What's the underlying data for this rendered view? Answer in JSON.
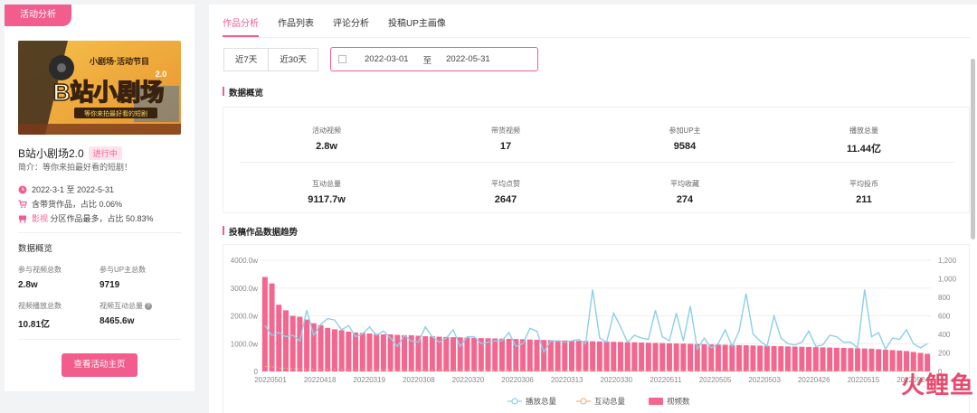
{
  "left": {
    "tag": "活动分析",
    "banner": {
      "text_top": "小剧场·活动节目",
      "text_main": "B站小剧场",
      "text_version": "2.0",
      "text_sub": "等你来拍最好看的短剧"
    },
    "title": "B站小剧场2.0",
    "status": "进行中",
    "intro": "简介：等你来拍最好看的短剧！",
    "date_range": "2022-3-1 至 2022-5-31",
    "goods_text": "含带货作品，占比 0.06%",
    "category_prefix": "影视",
    "category_text": "分区作品最多，占比 50.83%",
    "overview_title": "数据概览",
    "stats": [
      {
        "label": "参与视频总数",
        "value": "2.8w"
      },
      {
        "label": "参与UP主总数",
        "value": "9719"
      },
      {
        "label": "视频播放总数",
        "value": "10.81亿"
      },
      {
        "label": "视频互动总量",
        "value": "8465.6w"
      }
    ],
    "button": "查看活动主页"
  },
  "tabs": [
    "作品分析",
    "作品列表",
    "评论分析",
    "投稿UP主画像"
  ],
  "range_buttons": [
    "近7天",
    "近30天"
  ],
  "date_picker": {
    "start": "2022-03-01",
    "sep": "至",
    "end": "2022-05-31"
  },
  "section_overview": "数据概览",
  "overview": [
    {
      "label": "活动视频",
      "value": "2.8w"
    },
    {
      "label": "带货视频",
      "value": "17"
    },
    {
      "label": "参加UP主",
      "value": "9584"
    },
    {
      "label": "播放总量",
      "value": "11.44亿"
    },
    {
      "label": "互动总量",
      "value": "9117.7w"
    },
    {
      "label": "平均点赞",
      "value": "2647"
    },
    {
      "label": "平均收藏",
      "value": "274"
    },
    {
      "label": "平均投币",
      "value": "211"
    }
  ],
  "section_trend": "投稿作品数据趋势",
  "watermark": {
    "c1": "火",
    "c2": "鲤",
    "c3": "鱼"
  },
  "colors": {
    "accent": "#f25d8e",
    "bar": "#f2668f",
    "line_play": "#8ecfe6",
    "line_interact": "#f5b27a"
  },
  "chart_data": {
    "type": "bar",
    "left_axis_ticks": [
      "4000.0w",
      "3000.0w",
      "2000.0w",
      "1000.0w",
      "0"
    ],
    "right_axis_ticks": [
      "1,200",
      "1,000",
      "800",
      "600",
      "400",
      "200",
      "0"
    ],
    "left_ylim": [
      0,
      4000
    ],
    "right_ylim": [
      0,
      1200
    ],
    "x_tick_labels": [
      "20220501",
      "20220418",
      "20220319",
      "20220308",
      "20220320",
      "20220306",
      "20220313",
      "20220330",
      "20220511",
      "20220505",
      "20220503",
      "20220426",
      "20220515",
      "20220524"
    ],
    "legend": [
      "播放总量",
      "互动总量",
      "视频数"
    ],
    "bar_values": [
      1020,
      950,
      720,
      660,
      600,
      590,
      560,
      520,
      500,
      470,
      455,
      445,
      430,
      420,
      415,
      410,
      405,
      400,
      400,
      395,
      390,
      390,
      385,
      380,
      378,
      375,
      372,
      370,
      368,
      365,
      362,
      360,
      358,
      356,
      354,
      352,
      350,
      348,
      345,
      342,
      340,
      338,
      336,
      334,
      332,
      330,
      328,
      326,
      324,
      322,
      320,
      318,
      316,
      314,
      312,
      310,
      308,
      306,
      304,
      302,
      300,
      298,
      296,
      294,
      292,
      290,
      288,
      286,
      284,
      282,
      280,
      278,
      276,
      274,
      272,
      270,
      268,
      266,
      264,
      262,
      260,
      258,
      256,
      254,
      252,
      250,
      248,
      246,
      240,
      235,
      230,
      225,
      220,
      210,
      200,
      190
    ],
    "play_values": [
      1650,
      1300,
      1400,
      1250,
      1300,
      1100,
      2200,
      1300,
      1700,
      1900,
      1850,
      1500,
      1650,
      1250,
      1350,
      1600,
      1300,
      1450,
      1200,
      900,
      1300,
      1100,
      1050,
      1600,
      1250,
      1050,
      1200,
      1500,
      900,
      1250,
      1250,
      1000,
      1050,
      1100,
      1100,
      1400,
      900,
      1000,
      1550,
      1450,
      700,
      1100,
      1100,
      1050,
      1100,
      1150,
      1000,
      2950,
      1200,
      1050,
      2100,
      1600,
      1050,
      1300,
      1200,
      1150,
      2200,
      1250,
      1100,
      2100,
      1100,
      2350,
      800,
      1200,
      850,
      1000,
      1500,
      900,
      1450,
      2800,
      1350,
      1100,
      900,
      2000,
      1200,
      1000,
      950,
      1050,
      1450,
      900,
      950,
      1300,
      1250,
      1050,
      1050,
      850,
      2950,
      1250,
      1400,
      800,
      1200,
      1150,
      1500,
      1000,
      850,
      1000
    ],
    "interact_values": [
      180,
      170,
      120,
      100,
      95,
      90,
      85,
      80,
      75,
      75,
      70,
      70,
      68,
      66,
      64,
      62,
      60,
      58,
      58,
      56,
      55,
      54,
      53,
      52,
      51,
      50,
      50,
      49,
      48,
      48,
      47,
      46,
      46,
      45,
      45,
      44,
      44,
      43,
      43,
      42,
      42,
      41,
      41,
      40,
      40,
      40,
      39,
      39,
      38,
      38,
      38,
      37,
      37,
      36,
      36,
      36,
      35,
      35,
      35,
      34,
      34,
      34,
      33,
      33,
      33,
      32,
      32,
      32,
      31,
      31,
      31,
      30,
      30,
      30,
      30,
      29,
      29,
      29,
      28,
      28,
      28,
      28,
      27,
      27,
      27,
      26,
      26,
      26,
      25,
      25,
      24,
      24,
      23,
      22,
      21,
      20
    ]
  }
}
